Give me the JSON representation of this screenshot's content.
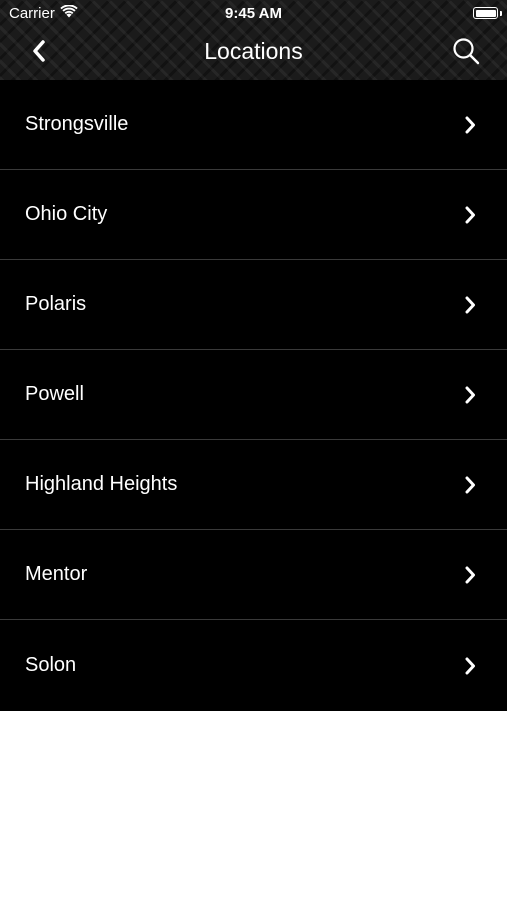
{
  "status_bar": {
    "carrier": "Carrier",
    "time": "9:45 AM"
  },
  "nav": {
    "title": "Locations",
    "back_icon": "back-chevron-icon",
    "search_icon": "search-icon"
  },
  "locations": [
    {
      "label": "Strongsville"
    },
    {
      "label": "Ohio City"
    },
    {
      "label": "Polaris"
    },
    {
      "label": "Powell"
    },
    {
      "label": "Highland Heights"
    },
    {
      "label": "Mentor"
    },
    {
      "label": "Solon"
    }
  ],
  "colors": {
    "list_background": "#000000",
    "separator": "#3a3a3a",
    "text": "#ffffff",
    "page_background": "#ffffff"
  }
}
